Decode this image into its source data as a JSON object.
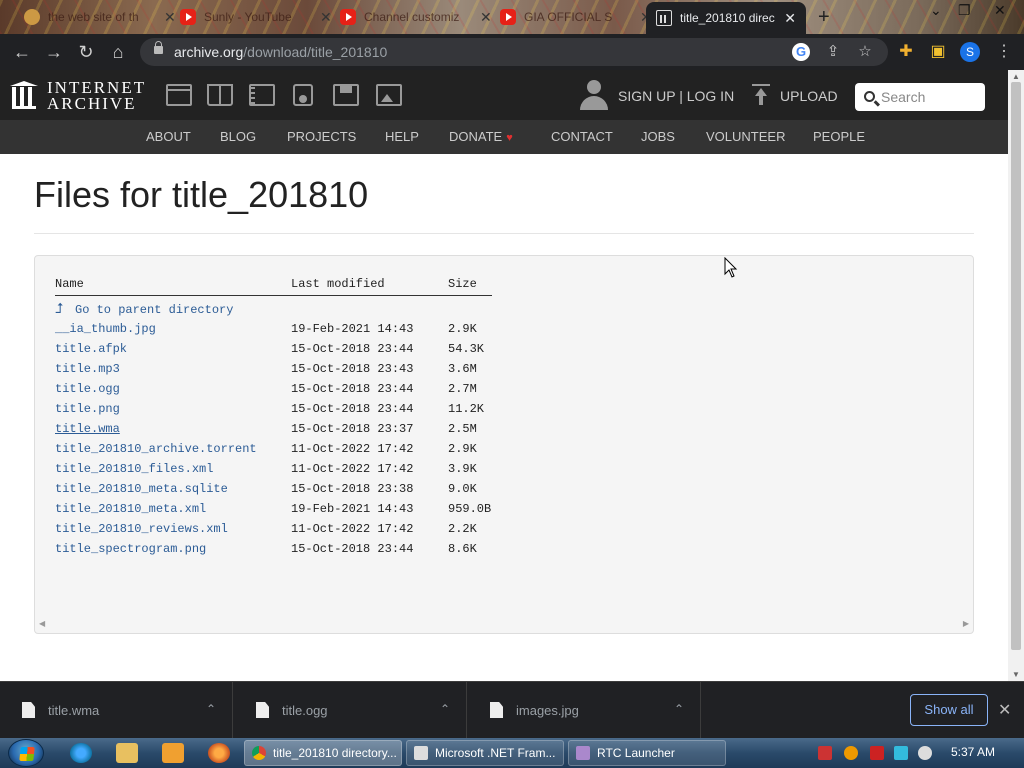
{
  "browser": {
    "tabs": [
      {
        "title": "the web site of th",
        "icon": "site-icon",
        "active": false
      },
      {
        "title": "Sunly - YouTube",
        "icon": "youtube-icon",
        "active": false
      },
      {
        "title": "Channel customiz",
        "icon": "youtube-icon",
        "active": false
      },
      {
        "title": "GIA OFFICIAL S",
        "icon": "youtube-icon",
        "active": false
      },
      {
        "title": "title_201810 direc",
        "icon": "internet-archive-icon",
        "active": true
      }
    ],
    "url_host": "archive.org",
    "url_path": "/download/title_201810",
    "profile_initial": "S"
  },
  "ia": {
    "logo_line1": "INTERNET",
    "logo_line2": "ARCHIVE",
    "signup_label": "SIGN UP | LOG IN",
    "upload_label": "UPLOAD",
    "search_placeholder": "Search",
    "nav": [
      "ABOUT",
      "BLOG",
      "PROJECTS",
      "HELP",
      "DONATE",
      "CONTACT",
      "JOBS",
      "VOLUNTEER",
      "PEOPLE"
    ]
  },
  "page": {
    "title": "Files for title_201810",
    "columns": {
      "name": "Name",
      "modified": "Last modified",
      "size": "Size"
    },
    "parent_link": "Go to parent directory",
    "files": [
      {
        "name": "__ia_thumb.jpg",
        "modified": "19-Feb-2021 14:43",
        "size": "2.9K"
      },
      {
        "name": "title.afpk",
        "modified": "15-Oct-2018 23:44",
        "size": "54.3K"
      },
      {
        "name": "title.mp3",
        "modified": "15-Oct-2018 23:43",
        "size": "3.6M"
      },
      {
        "name": "title.ogg",
        "modified": "15-Oct-2018 23:44",
        "size": "2.7M"
      },
      {
        "name": "title.png",
        "modified": "15-Oct-2018 23:44",
        "size": "11.2K"
      },
      {
        "name": "title.wma",
        "modified": "15-Oct-2018 23:37",
        "size": "2.5M"
      },
      {
        "name": "title_201810_archive.torrent",
        "modified": "11-Oct-2022 17:42",
        "size": "2.9K"
      },
      {
        "name": "title_201810_files.xml",
        "modified": "11-Oct-2022 17:42",
        "size": "3.9K"
      },
      {
        "name": "title_201810_meta.sqlite",
        "modified": "15-Oct-2018 23:38",
        "size": "9.0K"
      },
      {
        "name": "title_201810_meta.xml",
        "modified": "19-Feb-2021 14:43",
        "size": "959.0B"
      },
      {
        "name": "title_201810_reviews.xml",
        "modified": "11-Oct-2022 17:42",
        "size": "2.2K"
      },
      {
        "name": "title_spectrogram.png",
        "modified": "15-Oct-2018 23:44",
        "size": "8.6K"
      }
    ]
  },
  "downloads": {
    "items": [
      "title.wma",
      "title.ogg",
      "images.jpg"
    ],
    "show_all_label": "Show all"
  },
  "taskbar": {
    "tasks": [
      "title_201810 directory...",
      "Microsoft .NET Fram...",
      "RTC Launcher"
    ],
    "clock": "5:37 AM"
  },
  "colors": {
    "link": "#2c5c96",
    "ia_dark": "#222222",
    "chrome_dark": "#202124"
  }
}
